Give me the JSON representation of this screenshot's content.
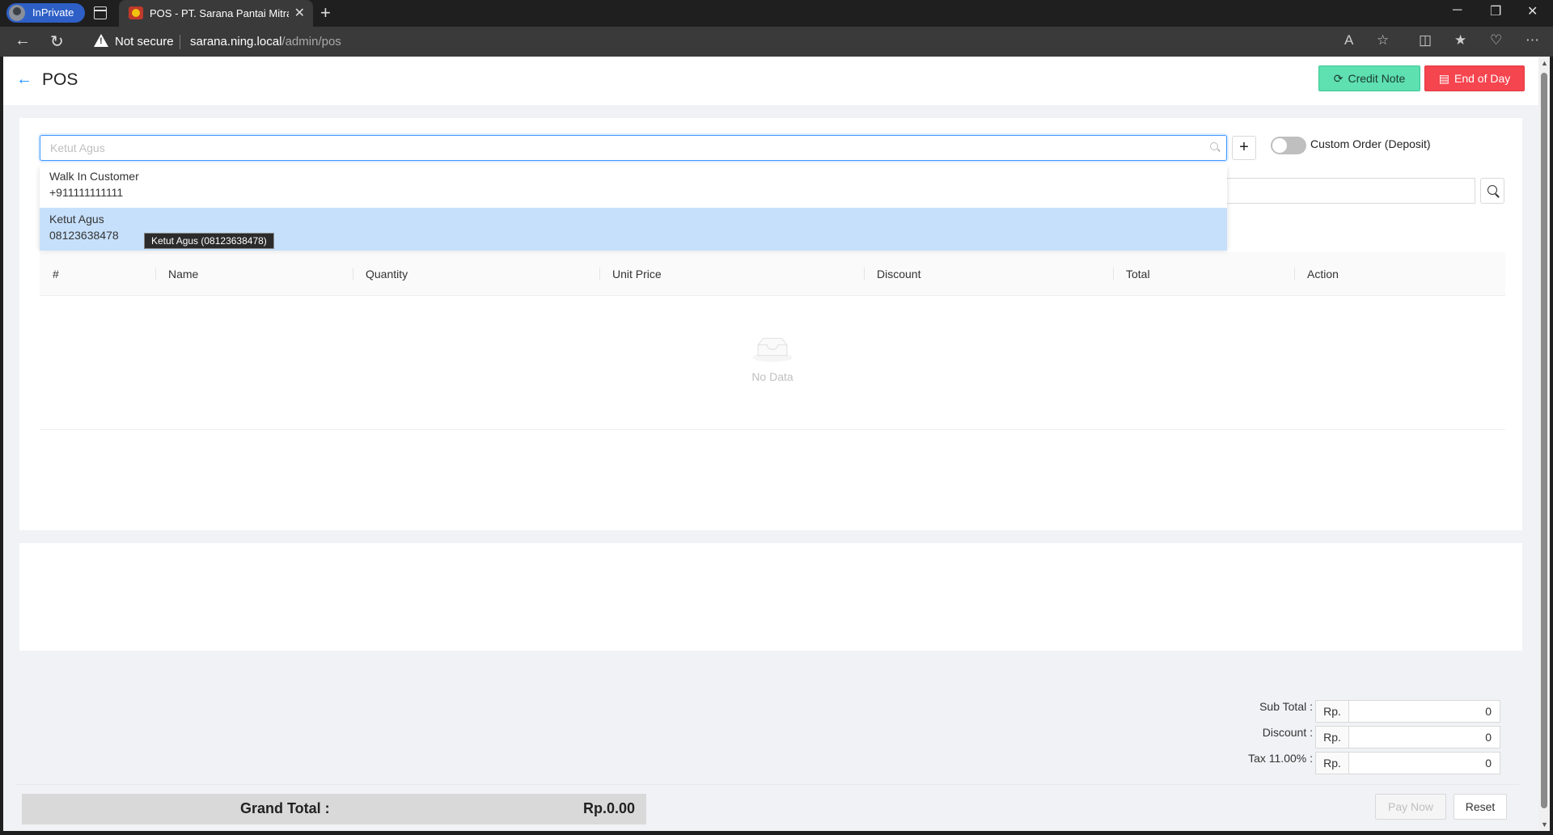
{
  "browser": {
    "inprivate_label": "InPrivate",
    "tab_title": "POS - PT. Sarana Pantai Mitra Se",
    "not_secure": "Not secure",
    "url_host": "sarana.ning.local",
    "url_path": "/admin/pos"
  },
  "header": {
    "title": "POS",
    "credit_note_label": "Credit Note",
    "end_of_day_label": "End of Day"
  },
  "customer": {
    "placeholder": "Ketut Agus",
    "custom_order_label": "Custom Order (Deposit)",
    "options": [
      {
        "name": "Walk In Customer",
        "phone": "+911111111111"
      },
      {
        "name": "Ketut Agus",
        "phone": "08123638478"
      }
    ],
    "tooltip": "Ketut Agus (08123638478)"
  },
  "table": {
    "columns": [
      "#",
      "Name",
      "Quantity",
      "Unit Price",
      "Discount",
      "Total",
      "Action"
    ],
    "empty_text": "No Data"
  },
  "summary": {
    "currency_prefix": "Rp.",
    "rows": [
      {
        "label": "Sub Total :",
        "value": "0"
      },
      {
        "label": "Discount :",
        "value": "0"
      },
      {
        "label": "Tax 11.00% :",
        "value": "0"
      }
    ],
    "grand_total_label": "Grand Total :",
    "grand_total_value": "Rp.0.00",
    "pay_now_label": "Pay Now",
    "reset_label": "Reset"
  },
  "colors": {
    "accent": "#1890ff",
    "credit_note": "#5ee0b0",
    "end_of_day": "#f5454f",
    "selected_option": "#c6e0fb"
  }
}
